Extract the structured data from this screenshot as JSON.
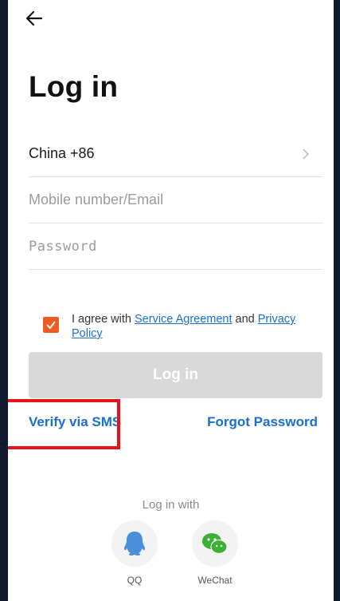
{
  "header": {
    "back_icon": "arrow-left-icon"
  },
  "page": {
    "title": "Log in"
  },
  "form": {
    "country": "China +86",
    "mobile_placeholder": "Mobile number/Email",
    "password_placeholder": "Password"
  },
  "agreement": {
    "prefix": "I agree with ",
    "service_link": "Service Agreement",
    "middle": " and ",
    "privacy_link": "Privacy Policy",
    "checked": true
  },
  "buttons": {
    "login": "Log in",
    "verify_sms": "Verify via SMS",
    "forgot": "Forgot Password"
  },
  "social": {
    "heading": "Log in with",
    "items": [
      {
        "label": "QQ",
        "icon": "qq-icon"
      },
      {
        "label": "WeChat",
        "icon": "wechat-icon"
      }
    ]
  },
  "colors": {
    "accent": "#1a6fd0",
    "checkbox": "#f05a22",
    "disabled_button": "#d9d9d9",
    "highlight": "#e8121a"
  }
}
